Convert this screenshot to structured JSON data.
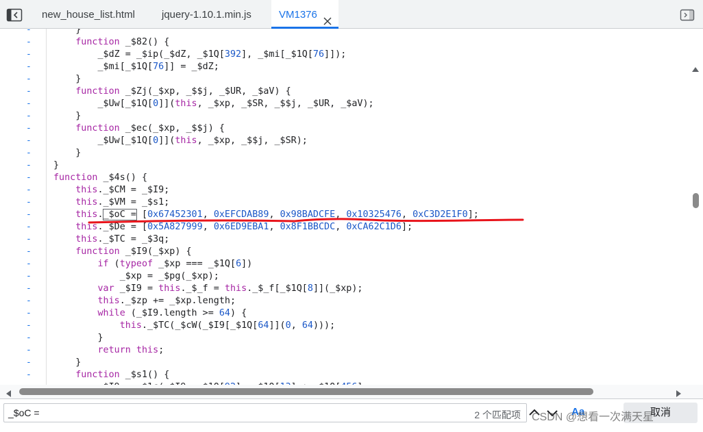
{
  "tabs": [
    {
      "label": "new_house_list.html",
      "active": false
    },
    {
      "label": "jquery-1.10.1.min.js",
      "active": false
    },
    {
      "label": "VM1376",
      "active": true
    }
  ],
  "gutter_marker": "-",
  "code_lines": [
    [
      [
        "p",
        "    }"
      ]
    ],
    [
      [
        "p",
        "    "
      ],
      [
        "k",
        "function"
      ],
      [
        "p",
        " _$82() {"
      ]
    ],
    [
      [
        "p",
        "        _$dZ = _$ip(_$dZ, _$1Q["
      ],
      [
        "n",
        "392"
      ],
      [
        "p",
        "], _$mi[_$1Q["
      ],
      [
        "n",
        "76"
      ],
      [
        "p",
        "]]);"
      ]
    ],
    [
      [
        "p",
        "        _$mi[_$1Q["
      ],
      [
        "n",
        "76"
      ],
      [
        "p",
        "]] = _$dZ;"
      ]
    ],
    [
      [
        "p",
        "    }"
      ]
    ],
    [
      [
        "p",
        "    "
      ],
      [
        "k",
        "function"
      ],
      [
        "p",
        " _$Zj(_$xp, _$$j, _$UR, _$aV) {"
      ]
    ],
    [
      [
        "p",
        "        _$Uw[_$1Q["
      ],
      [
        "n",
        "0"
      ],
      [
        "p",
        "]]("
      ],
      [
        "k",
        "this"
      ],
      [
        "p",
        ", _$xp, _$SR, _$$j, _$UR, _$aV);"
      ]
    ],
    [
      [
        "p",
        "    }"
      ]
    ],
    [
      [
        "p",
        "    "
      ],
      [
        "k",
        "function"
      ],
      [
        "p",
        " _$ec(_$xp, _$$j) {"
      ]
    ],
    [
      [
        "p",
        "        _$Uw[_$1Q["
      ],
      [
        "n",
        "0"
      ],
      [
        "p",
        "]]("
      ],
      [
        "k",
        "this"
      ],
      [
        "p",
        ", _$xp, _$$j, _$SR);"
      ]
    ],
    [
      [
        "p",
        "    }"
      ]
    ],
    [
      [
        "p",
        "}"
      ]
    ],
    [
      [
        "k",
        "function"
      ],
      [
        "p",
        " _$4s() {"
      ]
    ],
    [
      [
        "p",
        "    "
      ],
      [
        "k",
        "this"
      ],
      [
        "p",
        "._$CM = _$I9;"
      ]
    ],
    [
      [
        "p",
        "    "
      ],
      [
        "k",
        "this"
      ],
      [
        "p",
        "._$VM = _$s1;"
      ]
    ],
    [
      [
        "p",
        "    "
      ],
      [
        "k",
        "this"
      ],
      [
        "p",
        "."
      ],
      [
        "h",
        "_$oC ="
      ],
      [
        "p",
        " ["
      ],
      [
        "n",
        "0x67452301"
      ],
      [
        "p",
        ", "
      ],
      [
        "n",
        "0xEFCDAB89"
      ],
      [
        "p",
        ", "
      ],
      [
        "n",
        "0x98BADCFE"
      ],
      [
        "p",
        ", "
      ],
      [
        "n",
        "0x10325476"
      ],
      [
        "p",
        ", "
      ],
      [
        "n",
        "0xC3D2E1F0"
      ],
      [
        "p",
        "];"
      ]
    ],
    [
      [
        "p",
        "    "
      ],
      [
        "k",
        "this"
      ],
      [
        "p",
        "._$De = ["
      ],
      [
        "n",
        "0x5A827999"
      ],
      [
        "p",
        ", "
      ],
      [
        "n",
        "0x6ED9EBA1"
      ],
      [
        "p",
        ", "
      ],
      [
        "n",
        "0x8F1BBCDC"
      ],
      [
        "p",
        ", "
      ],
      [
        "n",
        "0xCA62C1D6"
      ],
      [
        "p",
        "];"
      ]
    ],
    [
      [
        "p",
        "    "
      ],
      [
        "k",
        "this"
      ],
      [
        "p",
        "._$TC = _$3q;"
      ]
    ],
    [
      [
        "p",
        "    "
      ],
      [
        "k",
        "function"
      ],
      [
        "p",
        " _$I9(_$xp) {"
      ]
    ],
    [
      [
        "p",
        "        "
      ],
      [
        "k",
        "if"
      ],
      [
        "p",
        " ("
      ],
      [
        "k",
        "typeof"
      ],
      [
        "p",
        " _$xp === _$1Q["
      ],
      [
        "n",
        "6"
      ],
      [
        "p",
        "])"
      ]
    ],
    [
      [
        "p",
        "            _$xp = _$pg(_$xp);"
      ]
    ],
    [
      [
        "p",
        "        "
      ],
      [
        "k",
        "var"
      ],
      [
        "p",
        " _$I9 = "
      ],
      [
        "k",
        "this"
      ],
      [
        "p",
        "._$_f = "
      ],
      [
        "k",
        "this"
      ],
      [
        "p",
        "._$_f[_$1Q["
      ],
      [
        "n",
        "8"
      ],
      [
        "p",
        "]](_$xp);"
      ]
    ],
    [
      [
        "p",
        "        "
      ],
      [
        "k",
        "this"
      ],
      [
        "p",
        "._$zp += _$xp.length;"
      ]
    ],
    [
      [
        "p",
        "        "
      ],
      [
        "k",
        "while"
      ],
      [
        "p",
        " (_$I9.length >= "
      ],
      [
        "n",
        "64"
      ],
      [
        "p",
        ") {"
      ]
    ],
    [
      [
        "p",
        "            "
      ],
      [
        "k",
        "this"
      ],
      [
        "p",
        "._$TC(_$cW(_$I9[_$1Q["
      ],
      [
        "n",
        "64"
      ],
      [
        "p",
        "]]("
      ],
      [
        "n",
        "0"
      ],
      [
        "p",
        ", "
      ],
      [
        "n",
        "64"
      ],
      [
        "p",
        ")));"
      ]
    ],
    [
      [
        "p",
        "        }"
      ]
    ],
    [
      [
        "p",
        "        "
      ],
      [
        "k",
        "return"
      ],
      [
        "p",
        " "
      ],
      [
        "k",
        "this"
      ],
      [
        "p",
        ";"
      ]
    ],
    [
      [
        "p",
        "    }"
      ]
    ],
    [
      [
        "p",
        "    "
      ],
      [
        "k",
        "function"
      ],
      [
        "p",
        " _$s1() {"
      ]
    ],
    [
      [
        "p",
        "        _$I9 = _$1c(_$I9, _$1Q["
      ],
      [
        "n",
        "92"
      ],
      [
        "p",
        "], _$1Q["
      ],
      [
        "n",
        "13"
      ],
      [
        "p",
        "] + _$1Q["
      ],
      [
        "n",
        "456"
      ],
      [
        "p",
        "]"
      ]
    ]
  ],
  "search": {
    "query": "_$oC =",
    "match_count": "2 个匹配项",
    "match_case_label": "Aa",
    "cancel_label": "取消"
  },
  "watermark": "CSDN @想看一次满天星",
  "colors": {
    "keyword": "#a626a4",
    "number": "#1a57c7",
    "accent": "#1a73e8",
    "annotation": "#e8141b"
  },
  "icons": [
    "navigator-toggle-icon",
    "close-icon",
    "debugger-toggle-icon",
    "chevron-up-icon",
    "chevron-down-icon",
    "scroll-up-arrow-icon",
    "scroll-down-arrow-icon",
    "scroll-left-arrow-icon",
    "scroll-right-arrow-icon"
  ]
}
